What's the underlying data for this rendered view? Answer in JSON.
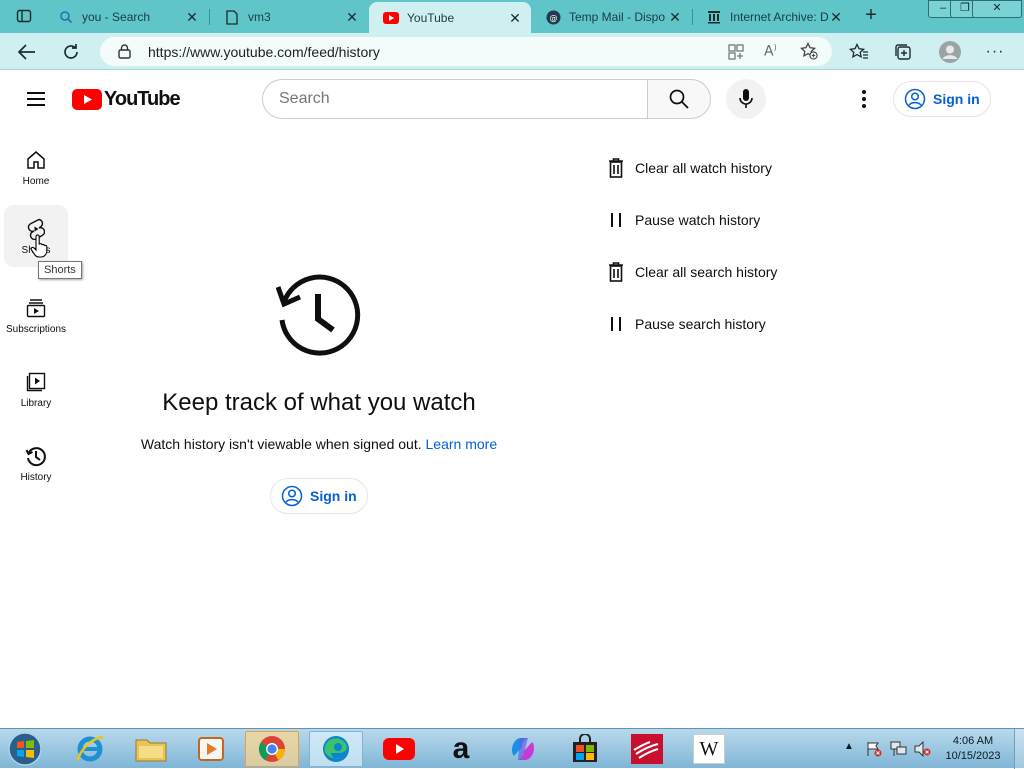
{
  "browser": {
    "tabs": [
      {
        "label": "you - Search",
        "icon": "search-icon"
      },
      {
        "label": "vm3",
        "icon": "document-icon"
      },
      {
        "label": "YouTube",
        "icon": "youtube-icon",
        "active": true
      },
      {
        "label": "Temp Mail - Dispo",
        "icon": "tempmail-icon"
      },
      {
        "label": "Internet Archive: D",
        "icon": "archive-icon"
      }
    ],
    "new_tab": "+",
    "window_controls": {
      "minimize": "–",
      "restore": "❐",
      "close": "✕"
    },
    "url": "https://www.youtube.com/feed/history",
    "colors": {
      "frame": "#5fc5c9",
      "toolbar": "#cfeff0"
    }
  },
  "youtube": {
    "logo_text": "YouTube",
    "search_placeholder": "Search",
    "sign_in_label": "Sign in",
    "colors": {
      "brand_red": "#ff0000",
      "link_blue": "#065fd4"
    }
  },
  "guide": {
    "items": [
      {
        "label": "Home",
        "icon": "home-icon"
      },
      {
        "label": "Shorts",
        "icon": "shorts-icon",
        "hovered": true
      },
      {
        "label": "Subscriptions",
        "icon": "subscriptions-icon"
      },
      {
        "label": "Library",
        "icon": "library-icon"
      },
      {
        "label": "History",
        "icon": "history-icon"
      }
    ],
    "tooltip": "Shorts"
  },
  "main": {
    "title": "Keep track of what you watch",
    "description": "Watch history isn't viewable when signed out.",
    "learn_more": "Learn more",
    "sign_in_label": "Sign in"
  },
  "actions": [
    {
      "label": "Clear all watch history",
      "icon": "trash-icon"
    },
    {
      "label": "Pause watch history",
      "icon": "pause-icon"
    },
    {
      "label": "Clear all search history",
      "icon": "trash-icon"
    },
    {
      "label": "Pause search history",
      "icon": "pause-icon"
    }
  ],
  "taskbar": {
    "apps": [
      "start-icon",
      "internet-explorer-icon",
      "file-explorer-icon",
      "media-player-icon",
      "chrome-icon",
      "edge-icon",
      "youtube-app-icon",
      "amazon-icon",
      "copilot-icon",
      "store-icon",
      "bank-of-america-icon",
      "wikipedia-icon"
    ],
    "wikipedia_glyph": "W",
    "amazon_glyph": "a",
    "time": "4:06 AM",
    "date": "10/15/2023"
  }
}
